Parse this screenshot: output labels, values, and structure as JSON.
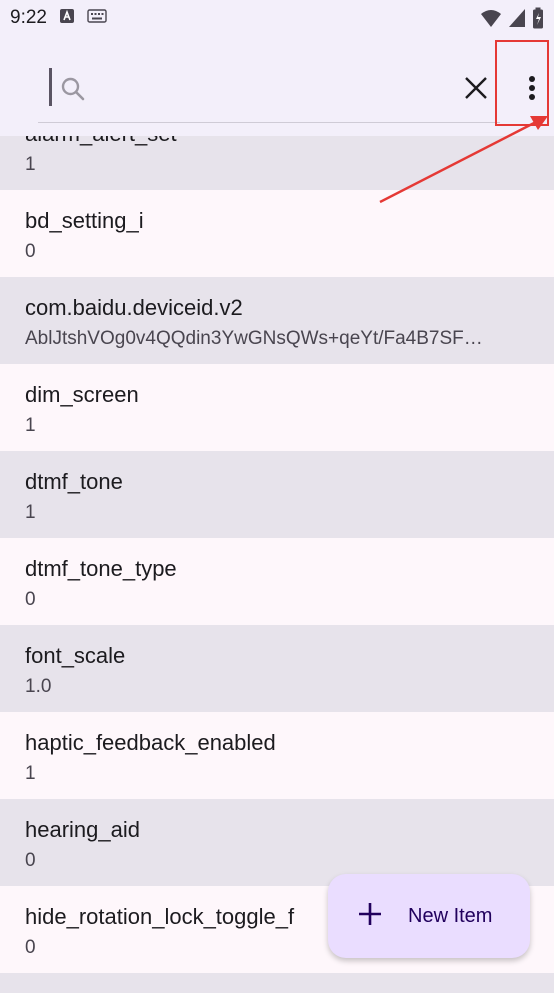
{
  "status_bar": {
    "time": "9:22",
    "left_icons": [
      "text-a-icon",
      "keyboard-icon"
    ],
    "right_icons": [
      "wifi-icon",
      "signal-icon",
      "battery-icon"
    ]
  },
  "search": {
    "placeholder": "",
    "value": ""
  },
  "toolbar": {
    "clear_icon": "close-icon",
    "more_icon": "more-vert-icon"
  },
  "items": [
    {
      "key": "alarm_alert_set",
      "value": "1"
    },
    {
      "key": "bd_setting_i",
      "value": "0"
    },
    {
      "key": "com.baidu.deviceid.v2",
      "value": "AblJtshVOg0v4QQdin3YwGNsQWs+qeYt/Fa4B7SF…"
    },
    {
      "key": "dim_screen",
      "value": "1"
    },
    {
      "key": "dtmf_tone",
      "value": "1"
    },
    {
      "key": "dtmf_tone_type",
      "value": "0"
    },
    {
      "key": "font_scale",
      "value": "1.0"
    },
    {
      "key": "haptic_feedback_enabled",
      "value": "1"
    },
    {
      "key": "hearing_aid",
      "value": "0"
    },
    {
      "key": "hide_rotation_lock_toggle_f",
      "value": "0"
    }
  ],
  "fab": {
    "label": "New Item",
    "icon": "plus-icon"
  },
  "colors": {
    "annotation": "#e53935",
    "fab_bg": "#eaddff",
    "row_shade": "#e7e3eb"
  }
}
